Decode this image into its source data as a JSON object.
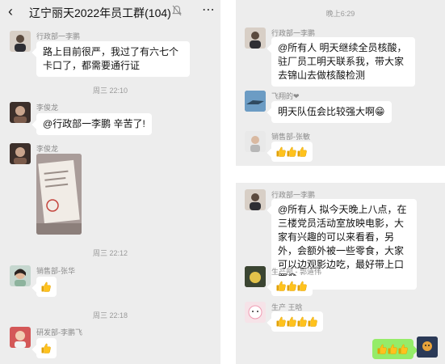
{
  "header": {
    "back_icon": "chevron-left-icon",
    "title": "辽宁丽天2022年员工群(104)",
    "mute_icon": "bell-muted-icon",
    "more_icon": "more-dots-icon"
  },
  "left": {
    "timestamps": [
      "周三 22:10",
      "周三 22:12",
      "周三 22:18"
    ],
    "messages": [
      {
        "sender": "行政部一李鹏",
        "text": "路上目前很严，我过了有六七个卡口了，都需要通行证"
      },
      {
        "sender": "李俊龙",
        "text": "@行政部一李鹏  辛苦了!"
      },
      {
        "sender": "李俊龙",
        "type": "image"
      },
      {
        "sender": "销售部-张华",
        "thumbs": 1
      },
      {
        "sender": "研发部-李鹏飞",
        "thumbs": 1
      }
    ]
  },
  "right_top": {
    "timestamp": "晚上6:29",
    "messages": [
      {
        "sender": "行政部一李鹏",
        "text": "@所有人  明天继续全员核酸，驻厂员工明天联系我，带大家去锦山去做核酸检测"
      },
      {
        "sender": "飞翔的❤",
        "text": "明天队伍会比较强大啊😁"
      },
      {
        "sender": "销售部-张敏",
        "thumbs": 3
      }
    ]
  },
  "right_bottom": {
    "messages": [
      {
        "sender": "行政部一李鹏",
        "text": "@所有人  拟今天晚上八点，在三楼党员活动室放映电影，大家有兴趣的可以来看看，另外，会额外被一些零食，大家可以边观影边吃，最好带上口罩😷"
      },
      {
        "sender": "生产部 - 郭道伟",
        "thumbs": 3
      },
      {
        "sender": "生产  王晗",
        "thumbs": 4
      },
      {
        "sender": "me",
        "thumbs": 3
      }
    ]
  },
  "colors": {
    "panel_bg": "#ededed",
    "bubble": "#ffffff",
    "my_bubble": "#95ec69",
    "thumb": "#f5b700"
  }
}
